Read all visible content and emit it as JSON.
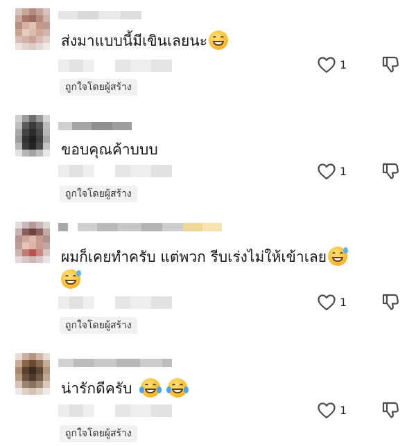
{
  "comments": [
    {
      "text": "ส่งมาแบบนี้มีเขินเลยนะ",
      "emoji": [
        "grinning-face-emoji"
      ],
      "likes": "1",
      "badge": "ถูกใจโดยผู้สร้าง"
    },
    {
      "text": "ขอบคุณค้าบบบ",
      "emoji": [],
      "likes": "1",
      "badge": "ถูกใจโดยผู้สร้าง"
    },
    {
      "text": "ผมก็เคยทำครับ แต่พวก รีบเร่งไม่ให้เข้าเลย",
      "emoji": [
        "grinning-sweat-emoji",
        "grinning-sweat-emoji"
      ],
      "likes": "1",
      "badge": "ถูกใจโดยผู้สร้าง"
    },
    {
      "text": "น่ารักดีครับ",
      "emoji": [
        "tears-of-joy-emoji",
        "tears-of-joy-emoji"
      ],
      "likes": "1",
      "badge": "ถูกใจโดยผู้สร้าง"
    }
  ],
  "colors": {
    "heart_outline": "#4a4a4a",
    "badge_bg": "#f1f1f1",
    "emoji_yellow": "#f6b728"
  },
  "icons": {
    "like": "heart-outline-icon",
    "dislike": "thumbs-down-outline-icon"
  }
}
